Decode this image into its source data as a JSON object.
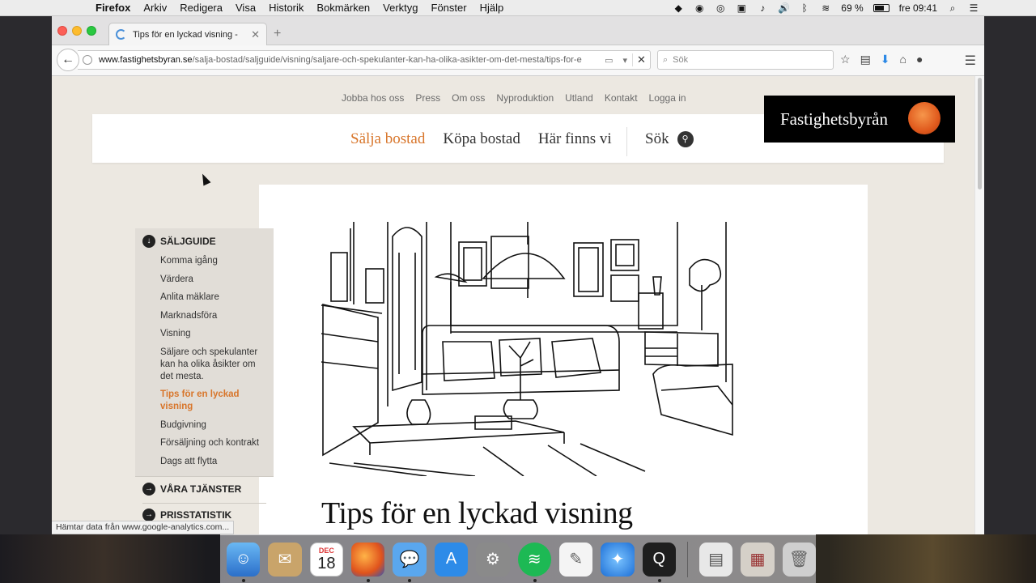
{
  "menubar": {
    "app": "Firefox",
    "items": [
      "Arkiv",
      "Redigera",
      "Visa",
      "Historik",
      "Bokmärken",
      "Verktyg",
      "Fönster",
      "Hjälp"
    ],
    "battery": "69 %",
    "clock": "fre 09:41"
  },
  "browser": {
    "tab_title": "Tips för en lyckad visning -",
    "url_domain": "www.fastighetsbyran.se",
    "url_path": "/salja-bostad/saljguide/visning/saljare-och-spekulanter-kan-ha-olika-asikter-om-det-mesta/tips-for-e",
    "search_placeholder": "Sök",
    "status_text": "Hämtar data från www.google-analytics.com..."
  },
  "site": {
    "toplinks": [
      "Jobba hos oss",
      "Press",
      "Om oss",
      "Nyproduktion",
      "Utland",
      "Kontakt",
      "Logga in"
    ],
    "mainnav": [
      "Sälja bostad",
      "Köpa bostad",
      "Här finns vi"
    ],
    "search_label": "Sök",
    "logo_text": "Fastighetsbyrån"
  },
  "sidebar": {
    "heading": "SÄLJGUIDE",
    "items": [
      "Komma igång",
      "Värdera",
      "Anlita mäklare",
      "Marknadsföra",
      "Visning",
      "Säljare och spekulanter kan ha olika åsikter om det mesta.",
      "Tips för en lyckad visning",
      "Budgivning",
      "Försäljning och kontrakt",
      "Dags att flytta"
    ],
    "section2": "VÅRA TJÄNSTER",
    "section3": "PRISSTATISTIK"
  },
  "article": {
    "title": "Tips för en lyckad visning"
  },
  "dock": {
    "calendar_month": "DEC",
    "calendar_day": "18"
  }
}
